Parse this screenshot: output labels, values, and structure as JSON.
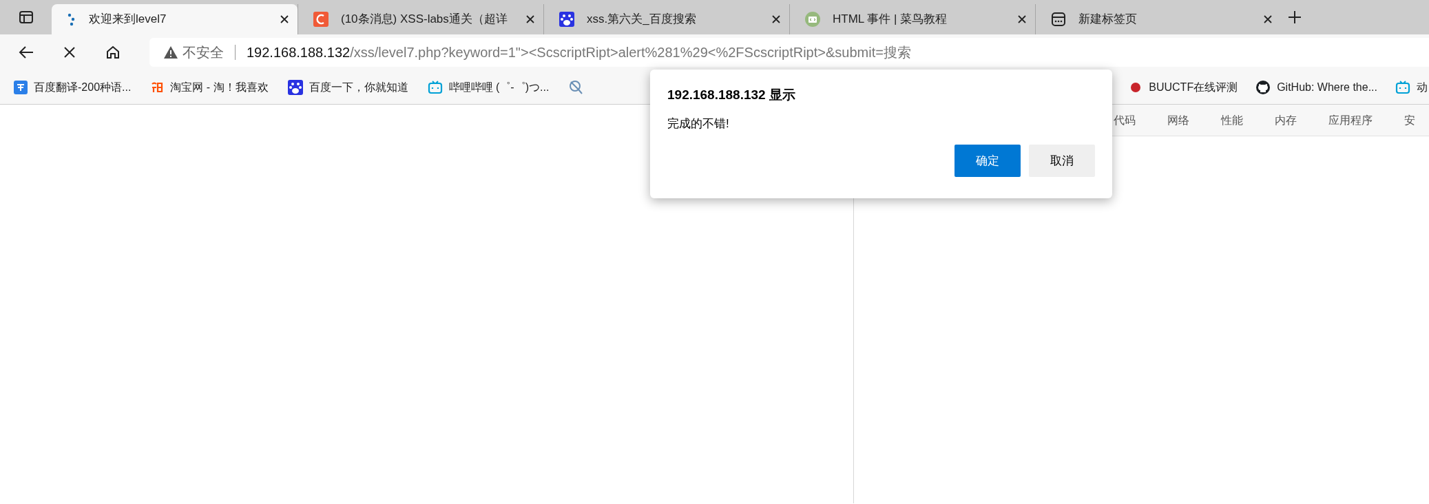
{
  "tabs": [
    {
      "title": "欢迎来到level7",
      "kind": "dots",
      "selected": true
    },
    {
      "title": "(10条消息) XSS-labs通关（超详",
      "kind": "csdn",
      "selected": false
    },
    {
      "title": "xss.第六关_百度搜索",
      "kind": "baidu",
      "selected": false
    },
    {
      "title": "HTML 事件 | 菜鸟教程",
      "kind": "runoob",
      "selected": false
    },
    {
      "title": "新建标签页",
      "kind": "newtab",
      "selected": false
    }
  ],
  "nav": {
    "loading": true
  },
  "address": {
    "security": "不安全",
    "host": "192.168.188.132",
    "path": "/xss/level7.php?keyword=1\"><ScscriptRipt>alert%281%29<%2FScscriptRipt>&submit=搜索"
  },
  "bookmarks": [
    {
      "label": "百度翻译-200种语...",
      "kind": "translate"
    },
    {
      "label": "淘宝网 - 淘！我喜欢",
      "kind": "taobao"
    },
    {
      "label": "百度一下，你就知道",
      "kind": "baidu"
    },
    {
      "label": "哔哩哔哩 (゜-゜)つ...",
      "kind": "bili"
    },
    {
      "kind": "magnifier"
    }
  ],
  "bookmarks_right": [
    {
      "label": "BUUCTF在线评测",
      "kind": "buuctf"
    },
    {
      "label": "GitHub: Where the...",
      "kind": "github"
    },
    {
      "label": "动",
      "kind": "bili"
    }
  ],
  "devtools_tabs": [
    "代码",
    "网络",
    "性能",
    "内存",
    "应用程序",
    "安"
  ],
  "dialog": {
    "title": "192.168.188.132 显示",
    "message": "完成的不错!",
    "buttons": [
      {
        "label": "确定",
        "primary": true
      },
      {
        "label": "取消",
        "primary": false
      }
    ]
  }
}
